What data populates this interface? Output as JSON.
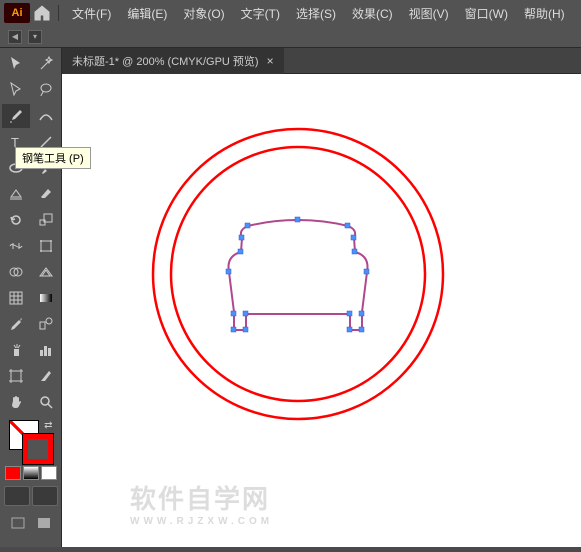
{
  "app": {
    "logo": "Ai"
  },
  "menu": {
    "file": "文件(F)",
    "edit": "编辑(E)",
    "object": "对象(O)",
    "text": "文字(T)",
    "select": "选择(S)",
    "effect": "效果(C)",
    "view": "视图(V)",
    "window": "窗口(W)",
    "help": "帮助(H)"
  },
  "tab": {
    "title": "未标题-1* @ 200% (CMYK/GPU 预览)",
    "close": "×"
  },
  "tooltip": {
    "pen": "钢笔工具 (P)"
  },
  "colors": {
    "stroke": "#f00",
    "fill": "none"
  },
  "watermark": {
    "main": "软件自学网",
    "sub": "WWW.RJZXW.COM"
  }
}
